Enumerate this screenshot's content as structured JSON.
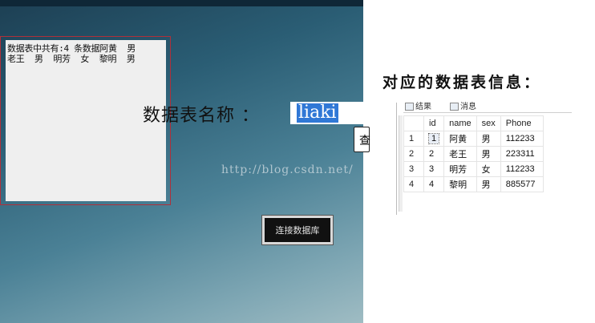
{
  "app": {
    "output_lines": [
      "数据表中共有:4 条数据阿黄  男",
      "老王  男  明芳  女  黎明  男"
    ],
    "table_label": "数据表名称 ：",
    "table_name_value": "liaki",
    "side_button_label": "查",
    "connect_button_label": "连接数据库",
    "watermark": "http://blog.csdn.net/"
  },
  "caption": "对应的数据表信息：",
  "grid": {
    "tabs": [
      "结果",
      "消息"
    ],
    "columns": [
      "",
      "id",
      "name",
      "sex",
      "Phone"
    ],
    "rows": [
      [
        "1",
        "1",
        "阿黄",
        "男",
        "112233"
      ],
      [
        "2",
        "2",
        "老王",
        "男",
        "223311"
      ],
      [
        "3",
        "3",
        "明芳",
        "女",
        "112233"
      ],
      [
        "4",
        "4",
        "黎明",
        "男",
        "885577"
      ]
    ]
  }
}
